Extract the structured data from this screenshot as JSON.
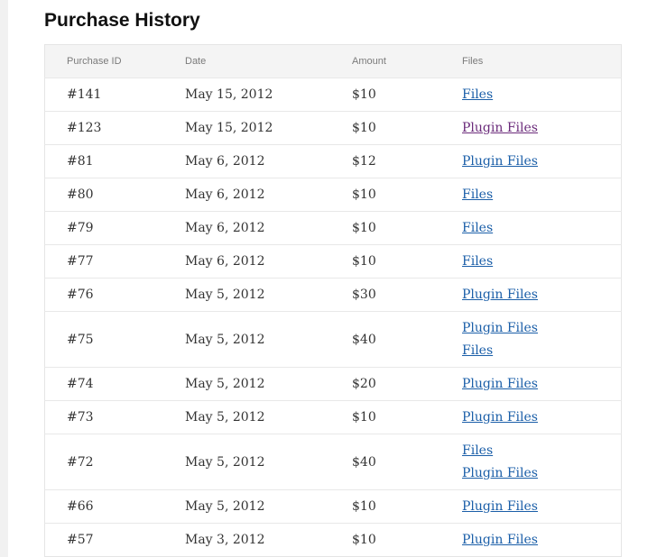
{
  "page": {
    "title": "Purchase History"
  },
  "table": {
    "headers": [
      "Purchase ID",
      "Date",
      "Amount",
      "Files"
    ],
    "rows": [
      {
        "id": "#141",
        "date": "May 15, 2012",
        "amount": "$10",
        "files": [
          {
            "label": "Files",
            "visited": false
          }
        ]
      },
      {
        "id": "#123",
        "date": "May 15, 2012",
        "amount": "$10",
        "files": [
          {
            "label": "Plugin Files",
            "visited": true
          }
        ]
      },
      {
        "id": "#81",
        "date": "May 6, 2012",
        "amount": "$12",
        "files": [
          {
            "label": "Plugin Files",
            "visited": false
          }
        ]
      },
      {
        "id": "#80",
        "date": "May 6, 2012",
        "amount": "$10",
        "files": [
          {
            "label": "Files",
            "visited": false
          }
        ]
      },
      {
        "id": "#79",
        "date": "May 6, 2012",
        "amount": "$10",
        "files": [
          {
            "label": "Files",
            "visited": false
          }
        ]
      },
      {
        "id": "#77",
        "date": "May 6, 2012",
        "amount": "$10",
        "files": [
          {
            "label": "Files",
            "visited": false
          }
        ]
      },
      {
        "id": "#76",
        "date": "May 5, 2012",
        "amount": "$30",
        "files": [
          {
            "label": "Plugin Files",
            "visited": false
          }
        ]
      },
      {
        "id": "#75",
        "date": "May 5, 2012",
        "amount": "$40",
        "files": [
          {
            "label": "Plugin Files",
            "visited": false
          },
          {
            "label": "Files",
            "visited": false
          }
        ]
      },
      {
        "id": "#74",
        "date": "May 5, 2012",
        "amount": "$20",
        "files": [
          {
            "label": "Plugin Files",
            "visited": false
          }
        ]
      },
      {
        "id": "#73",
        "date": "May 5, 2012",
        "amount": "$10",
        "files": [
          {
            "label": "Plugin Files",
            "visited": false
          }
        ]
      },
      {
        "id": "#72",
        "date": "May 5, 2012",
        "amount": "$40",
        "files": [
          {
            "label": "Files",
            "visited": false
          },
          {
            "label": "Plugin Files",
            "visited": false
          }
        ]
      },
      {
        "id": "#66",
        "date": "May 5, 2012",
        "amount": "$10",
        "files": [
          {
            "label": "Plugin Files",
            "visited": false
          }
        ]
      },
      {
        "id": "#57",
        "date": "May 3, 2012",
        "amount": "$10",
        "files": [
          {
            "label": "Plugin Files",
            "visited": false
          }
        ]
      }
    ]
  },
  "colors": {
    "link": "#1a5ea8",
    "link_visited": "#6a2a7a",
    "header_bg": "#f4f4f4",
    "border": "#e5e5e5"
  }
}
